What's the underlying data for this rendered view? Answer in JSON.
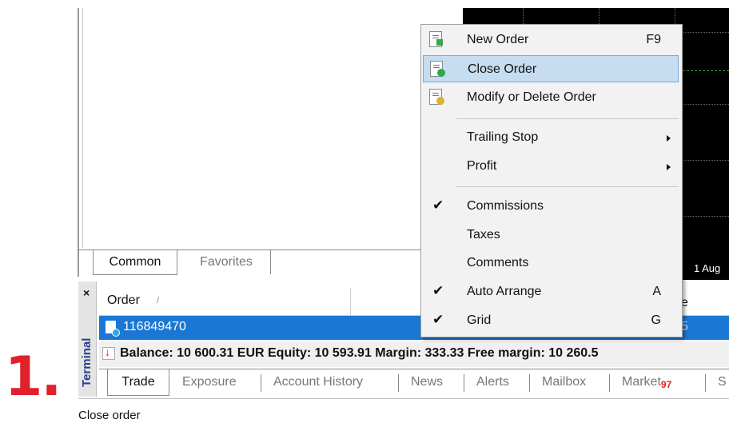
{
  "step_label": "1.",
  "navigator": {
    "tabs": [
      "Common",
      "Favorites"
    ]
  },
  "chart": {
    "date_label": "1 Aug"
  },
  "context_menu": {
    "items": [
      {
        "label": "New Order",
        "shortcut": "F9",
        "icon": "new-order-icon"
      },
      {
        "label": "Close Order",
        "icon": "close-order-icon",
        "highlighted": true
      },
      {
        "label": "Modify or Delete Order",
        "icon": "modify-order-icon"
      },
      {
        "label": "Trailing Stop",
        "submenu": true
      },
      {
        "label": "Profit",
        "submenu": true
      },
      {
        "label": "Commissions",
        "checked": true
      },
      {
        "label": "Taxes"
      },
      {
        "label": "Comments"
      },
      {
        "label": "Auto Arrange",
        "shortcut": "A",
        "checked": true
      },
      {
        "label": "Grid",
        "shortcut": "G",
        "checked": true
      }
    ]
  },
  "terminal": {
    "close": "×",
    "label": "Terminal",
    "columns": {
      "order": "Order",
      "sort": "/",
      "right_partial": "e"
    },
    "order_row": {
      "id": "116849470",
      "right_partial": "5"
    },
    "balance_line": "Balance: 10 600.31 EUR  Equity: 10 593.91  Margin: 333.33  Free margin: 10 260.5",
    "tabs": [
      "Trade",
      "Exposure",
      "Account History",
      "News",
      "Alerts",
      "Mailbox",
      "Market",
      "S"
    ],
    "market_badge": "97"
  },
  "status_bar": {
    "text": "Close order"
  },
  "colors": {
    "selection": "#1a78d4",
    "menu_highlight": "#c6dcf0",
    "step_label": "#e0202a",
    "badge": "#e02020"
  }
}
